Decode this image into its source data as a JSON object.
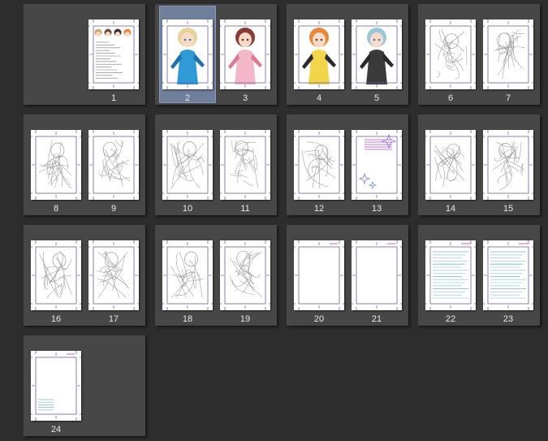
{
  "colors": {
    "background": "#2d2d2d",
    "spread": "#474747",
    "selection": "#6f7f9c",
    "page": "#ffffff",
    "guide": "#6a5fa8",
    "sketch": "#9a9a9a",
    "number_text": "#e8e8e8"
  },
  "selected_page": "2",
  "spreads": [
    {
      "pages": [
        null,
        {
          "number": "1",
          "content": "character-sheet"
        }
      ]
    },
    {
      "pages": [
        {
          "number": "2",
          "content": "color-illustration-blue"
        },
        {
          "number": "3",
          "content": "color-illustration-pink"
        }
      ]
    },
    {
      "pages": [
        {
          "number": "4",
          "content": "color-illustration-orange"
        },
        {
          "number": "5",
          "content": "color-illustration-dark"
        }
      ]
    },
    {
      "pages": [
        {
          "number": "6",
          "content": "line-sketch"
        },
        {
          "number": "7",
          "content": "line-sketch"
        }
      ]
    },
    {
      "pages": [
        {
          "number": "8",
          "content": "line-sketch"
        },
        {
          "number": "9",
          "content": "line-sketch"
        }
      ]
    },
    {
      "pages": [
        {
          "number": "10",
          "content": "line-sketch"
        },
        {
          "number": "11",
          "content": "line-sketch"
        }
      ]
    },
    {
      "pages": [
        {
          "number": "12",
          "content": "line-sketch"
        },
        {
          "number": "13",
          "content": "text-with-stars"
        }
      ]
    },
    {
      "pages": [
        {
          "number": "14",
          "content": "line-sketch"
        },
        {
          "number": "15",
          "content": "line-sketch"
        }
      ]
    },
    {
      "pages": [
        {
          "number": "16",
          "content": "line-sketch"
        },
        {
          "number": "17",
          "content": "line-sketch"
        }
      ]
    },
    {
      "pages": [
        {
          "number": "18",
          "content": "line-sketch"
        },
        {
          "number": "19",
          "content": "line-sketch"
        }
      ]
    },
    {
      "pages": [
        {
          "number": "20",
          "content": "blank-frame"
        },
        {
          "number": "21",
          "content": "blank-frame"
        }
      ]
    },
    {
      "pages": [
        {
          "number": "22",
          "content": "text-page"
        },
        {
          "number": "23",
          "content": "text-page"
        }
      ]
    },
    {
      "pages": [
        {
          "number": "24",
          "content": "colophon"
        },
        null
      ]
    }
  ]
}
